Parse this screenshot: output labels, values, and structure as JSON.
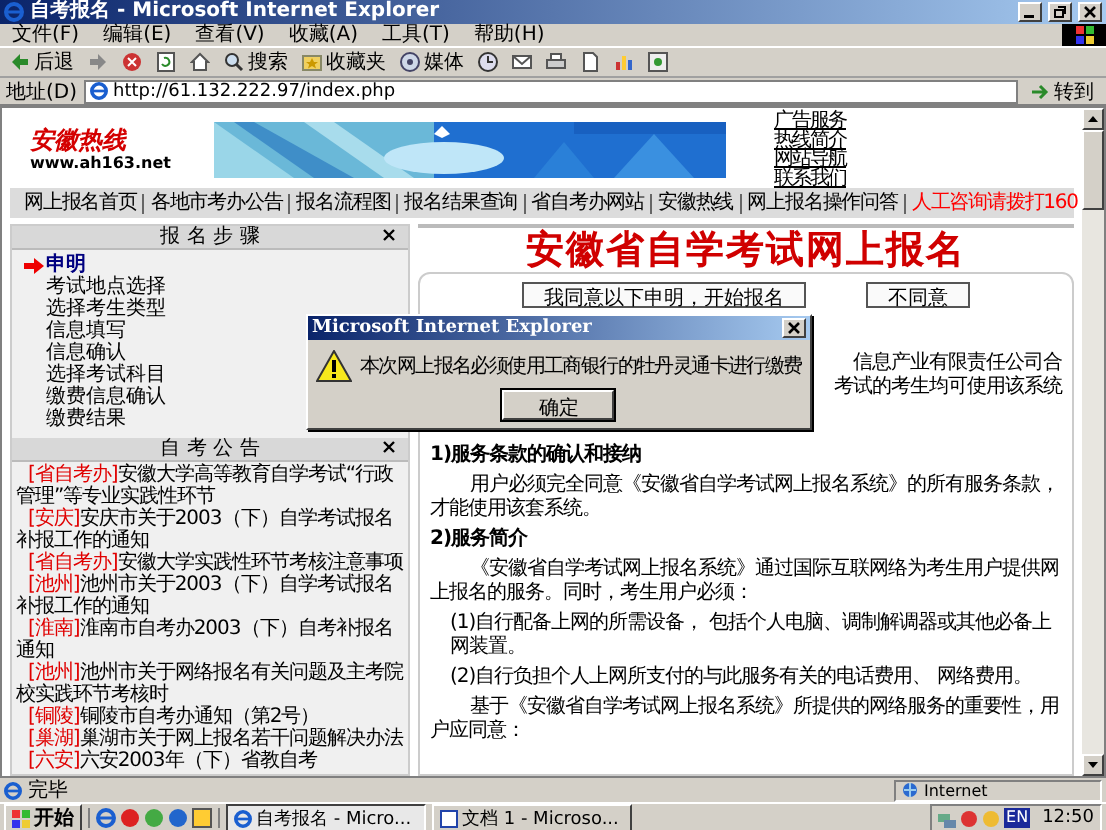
{
  "window": {
    "title": "自考报名 - Microsoft Internet Explorer"
  },
  "menu": [
    "文件(F)",
    "编辑(E)",
    "查看(V)",
    "收藏(A)",
    "工具(T)",
    "帮助(H)"
  ],
  "toolbar": [
    {
      "kind": "back",
      "label": "后退"
    },
    {
      "kind": "forward"
    },
    {
      "kind": "stop"
    },
    {
      "kind": "refresh"
    },
    {
      "kind": "home"
    },
    {
      "kind": "search",
      "label": "搜索"
    },
    {
      "kind": "favorites",
      "label": "收藏夹"
    },
    {
      "kind": "media",
      "label": "媒体"
    },
    {
      "kind": "history"
    },
    {
      "kind": "mail"
    },
    {
      "kind": "print"
    },
    {
      "kind": "edit"
    },
    {
      "kind": "discuss"
    },
    {
      "kind": "messenger"
    }
  ],
  "address": {
    "label": "地址(D)",
    "value": "http://61.132.222.97/index.php",
    "go": "转到"
  },
  "page": {
    "logo": {
      "name": "安徽热线",
      "url": "www.ah163.net"
    },
    "side_links": [
      "广告服务",
      "热线简介",
      "网站导航",
      "联系我们"
    ],
    "nav": [
      {
        "label": "网上报名首页",
        "color": "#000000"
      },
      {
        "label": "各地市考办公告",
        "color": "#000000"
      },
      {
        "label": "报名流程图",
        "color": "#000000"
      },
      {
        "label": "报名结果查询",
        "color": "#000000"
      },
      {
        "label": "省自考办网站",
        "color": "#000000"
      },
      {
        "label": "安徽热线",
        "color": "#000000"
      },
      {
        "label": "网上报名操作问答",
        "color": "#000000"
      },
      {
        "label": "人工咨询请拨打160",
        "color": "#ff0000"
      }
    ],
    "steps": {
      "title": "报 名 步 骤",
      "items": [
        {
          "label": "申明",
          "selected": true
        },
        {
          "label": "考试地点选择",
          "selected": false
        },
        {
          "label": "选择考生类型",
          "selected": false
        },
        {
          "label": "信息填写",
          "selected": false
        },
        {
          "label": "信息确认",
          "selected": false
        },
        {
          "label": "选择考试科目",
          "selected": false
        },
        {
          "label": "缴费信息确认",
          "selected": false
        },
        {
          "label": "缴费结果",
          "selected": false
        }
      ]
    },
    "notices": {
      "title": "自 考 公 告",
      "items": [
        {
          "tag": "[省自考办]",
          "text": "安徽大学高等教育自学考试“行政管理”等专业实践性环节"
        },
        {
          "tag": "[安庆]",
          "text": "安庆市关于2003（下）自学考试报名补报工作的通知"
        },
        {
          "tag": "[省自考办]",
          "text": "安徽大学实践性环节考核注意事项"
        },
        {
          "tag": "[池州]",
          "text": "池州市关于2003（下）自学考试报名补报工作的通知"
        },
        {
          "tag": "[淮南]",
          "text": "淮南市自考办2003（下）自考补报名通知"
        },
        {
          "tag": "[池州]",
          "text": "池州市关于网络报名有关问题及主考院校实践环节考核时"
        },
        {
          "tag": "[铜陵]",
          "text": "铜陵市自考办通知（第2号）"
        },
        {
          "tag": "[巢湖]",
          "text": "巢湖市关于网上报名若干问题解决办法"
        },
        {
          "tag": "[六安]",
          "text": "六安2003年（下）省教自考"
        }
      ]
    },
    "main": {
      "title": "安徽省自学考试网上报名",
      "buttons": [
        "我同意以下申明，开始报名",
        "不同意"
      ],
      "partial_lines": [
        "信息产业有限责任公司合",
        "考试的考生均可使用该系统"
      ],
      "sections": [
        {
          "kind": "heading",
          "text": "1)服务条款的确认和接纳"
        },
        {
          "kind": "para",
          "text": "用户必须完全同意《安徽省自学考试网上报名系统》的所有服务条款，才能使用该套系统。"
        },
        {
          "kind": "heading",
          "text": "2)服务简介"
        },
        {
          "kind": "para",
          "text": "《安徽省自学考试网上报名系统》通过国际互联网络为考生用户提供网上报名的服务。同时，考生用户必须："
        },
        {
          "kind": "item",
          "text": "(1)自行配备上网的所需设备， 包括个人电脑、调制解调器或其他必备上网装置。"
        },
        {
          "kind": "item",
          "text": "(2)自行负担个人上网所支付的与此服务有关的电话费用、 网络费用。"
        },
        {
          "kind": "para",
          "text": "基于《安徽省自学考试网上报名系统》所提供的网络服务的重要性，用户应同意："
        }
      ]
    }
  },
  "dialog": {
    "title": "Microsoft Internet Explorer",
    "message": "本次网上报名必须使用工商银行的牡丹灵通卡进行缴费",
    "button": "确定"
  },
  "status_bar": {
    "text": "完毕",
    "zone": "Internet"
  },
  "taskbar": {
    "start": "开始",
    "tasks": [
      {
        "label": "自考报名 - Micro...",
        "selected": true
      },
      {
        "label": "文档 1 - Microso...",
        "selected": false
      }
    ],
    "lang": "EN",
    "clock": "12:50"
  }
}
